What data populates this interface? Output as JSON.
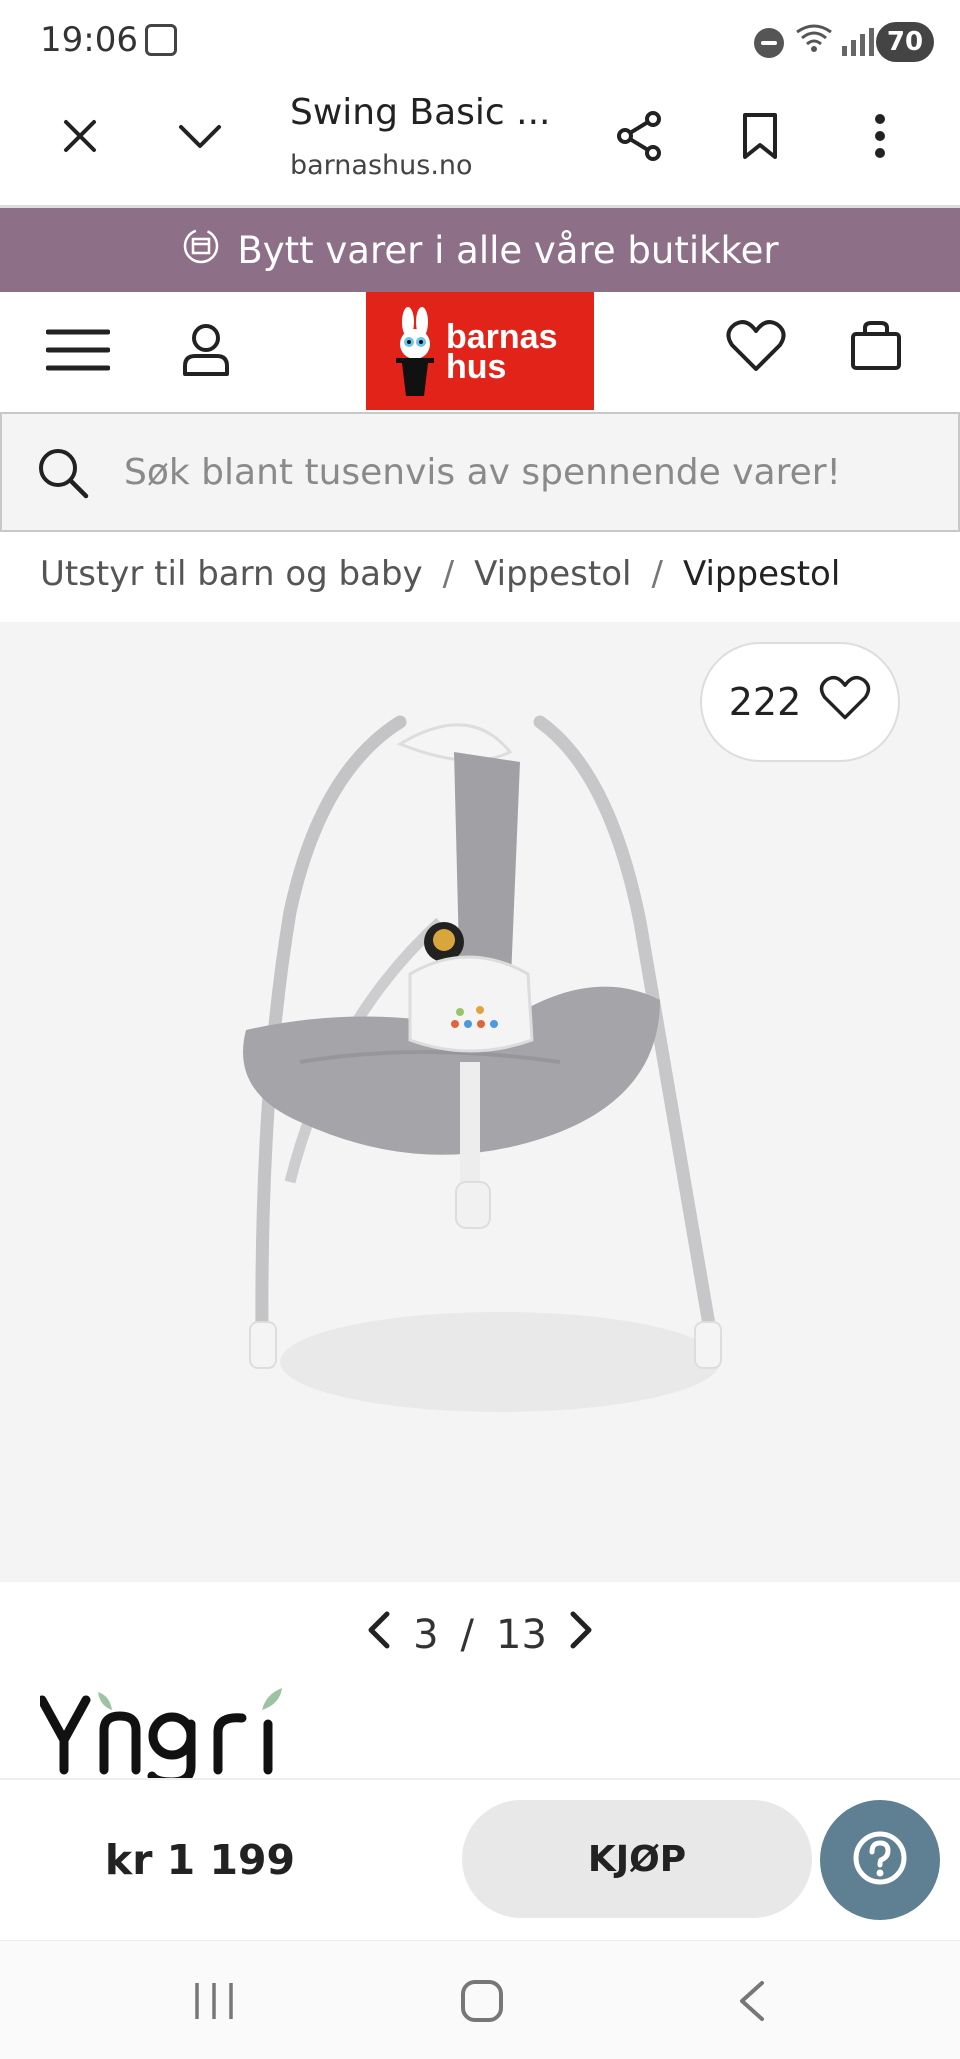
{
  "status_bar": {
    "time": "19:06",
    "battery": "70"
  },
  "browser": {
    "title": "Swing Basic ...",
    "url": "barnashus.no"
  },
  "banner": {
    "text": "Bytt varer i alle våre butikker"
  },
  "logo": {
    "line1": "barnas",
    "line2": "hus"
  },
  "search": {
    "placeholder": "Søk blant tusenvis av spennende varer!"
  },
  "breadcrumb": {
    "items": [
      "Utstyr til barn og baby",
      "Vippestol",
      "Vippestol"
    ],
    "separator": "/"
  },
  "gallery": {
    "like_count": "222",
    "current": "3",
    "separator": "/",
    "total": "13"
  },
  "product": {
    "brand": "Yngri",
    "price": "kr 1 199",
    "buy_label": "KJØP"
  },
  "colors": {
    "banner": "#8d7087",
    "logo_bg": "#e2231a",
    "help_button": "#5f7f92"
  },
  "icons": [
    "close-icon",
    "chevron-down-icon",
    "share-icon",
    "bookmark-icon",
    "more-vert-icon",
    "menu-icon",
    "user-icon",
    "heart-icon",
    "bag-icon",
    "search-icon",
    "chevron-left-icon",
    "chevron-right-icon",
    "help-icon"
  ]
}
